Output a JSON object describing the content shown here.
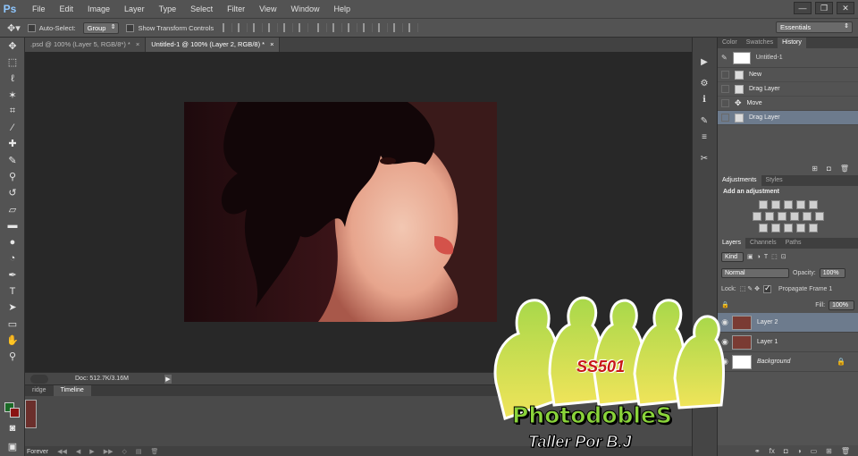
{
  "app": {
    "logo": "Ps"
  },
  "menu": [
    "File",
    "Edit",
    "Image",
    "Layer",
    "Type",
    "Select",
    "Filter",
    "View",
    "Window",
    "Help"
  ],
  "window_controls": [
    "—",
    "❐",
    "✕"
  ],
  "options": {
    "auto_select_label": "Auto-Select:",
    "auto_select_value": "Group",
    "transform_label": "Show Transform Controls",
    "workspace": "Essentials"
  },
  "tabs": [
    {
      "label": ".psd @ 100% (Layer 5, RGB/8*) *",
      "close": "×"
    },
    {
      "label": "Untitled-1 @ 100% (Layer 2, RGB/8) *",
      "close": "×"
    }
  ],
  "status": {
    "doc": "Doc: 512.7K/3.16M",
    "arrow": "▶"
  },
  "timeline": {
    "tabs": [
      "ridge",
      "Timeline"
    ],
    "loop": "Forever",
    "thumb_label": "0 sec."
  },
  "panels": {
    "top_tabs": [
      "Color",
      "Swatches",
      "History"
    ],
    "snapshot_name": "Untitled-1",
    "history": [
      "New",
      "Drag Layer",
      "Move",
      "Drag Layer"
    ],
    "adj_tabs": [
      "Adjustments",
      "Styles"
    ],
    "adj_title": "Add an adjustment",
    "layer_tabs": [
      "Layers",
      "Channels",
      "Paths"
    ],
    "kind": "Kind",
    "blend_mode": "Normal",
    "opacity_label": "Opacity:",
    "opacity": "100%",
    "lock_label": "Lock:",
    "propagate": "Propagate Frame 1",
    "fill_label": "Fill:",
    "fill": "100%",
    "layers": [
      "Layer 2",
      "Layer 1",
      "Background"
    ]
  },
  "watermark": {
    "badge": "SS501",
    "brand": "PhotodobleS",
    "tagline": "Taller Por B.J",
    "colors": {
      "green": "#7ec94a",
      "yellow": "#f2e64a",
      "outline": "#ffffff"
    }
  }
}
